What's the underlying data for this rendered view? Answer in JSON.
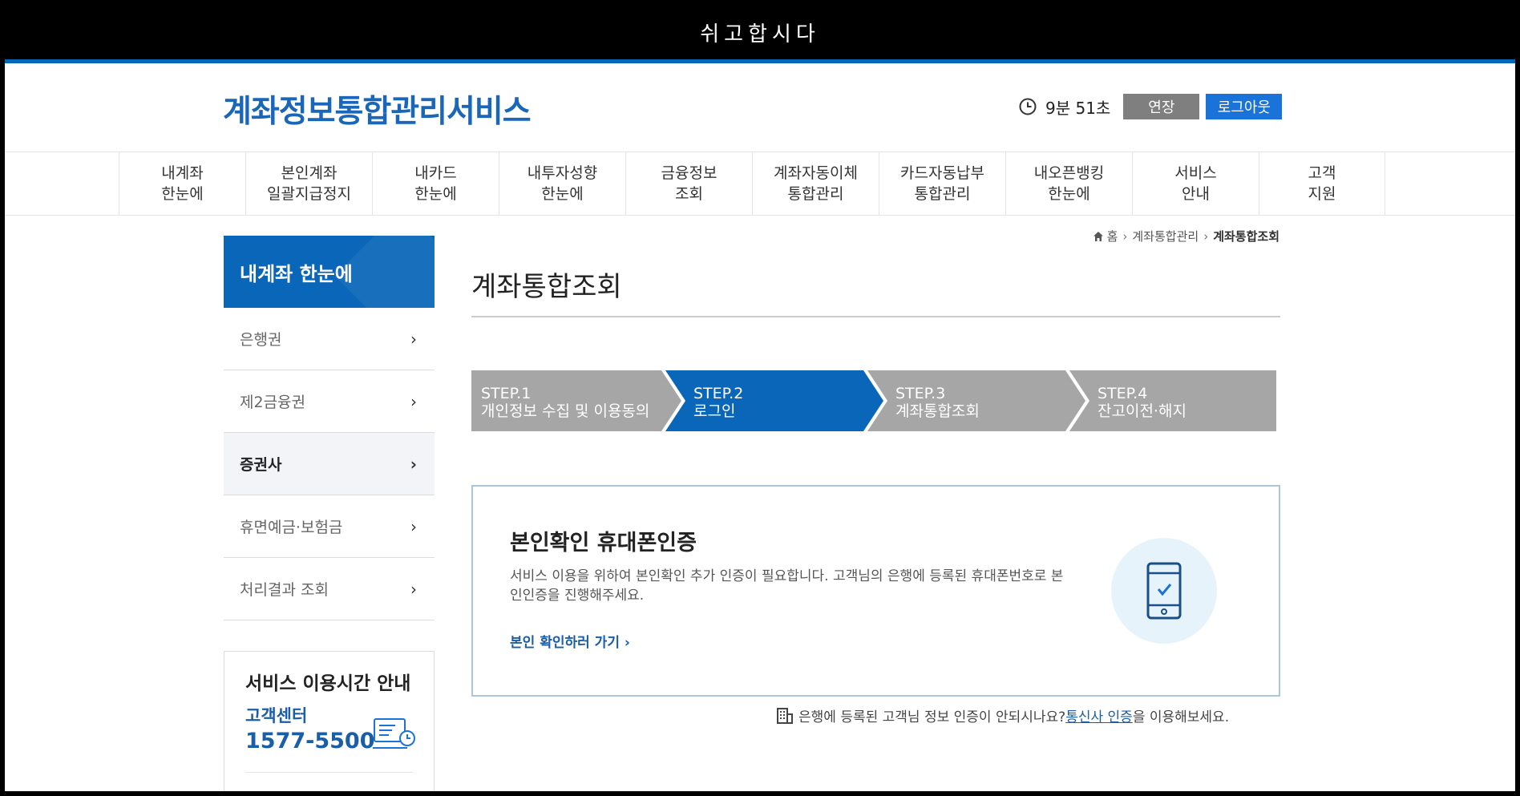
{
  "window": {
    "title": "쉬고합시다"
  },
  "header": {
    "logo": "계좌정보통합관리서비스",
    "session_timer": "9분 51초",
    "extend_label": "연장",
    "logout_label": "로그아웃"
  },
  "gnb": [
    {
      "label": "내계좌\n한눈에"
    },
    {
      "label": "본인계좌\n일괄지급정지"
    },
    {
      "label": "내카드\n한눈에"
    },
    {
      "label": "내투자성향\n한눈에"
    },
    {
      "label": "금융정보\n조회"
    },
    {
      "label": "계좌자동이체\n통합관리"
    },
    {
      "label": "카드자동납부\n통합관리"
    },
    {
      "label": "내오픈뱅킹\n한눈에"
    },
    {
      "label": "서비스\n안내"
    },
    {
      "label": "고객\n지원"
    }
  ],
  "breadcrumb": {
    "home": "홈",
    "level1": "계좌통합관리",
    "current": "계좌통합조회"
  },
  "sidebar": {
    "title": "내계좌 한눈에",
    "items": [
      {
        "label": "은행권"
      },
      {
        "label": "제2금융권"
      },
      {
        "label": "증권사"
      },
      {
        "label": "휴면예금·보험금"
      },
      {
        "label": "처리결과 조회"
      }
    ],
    "service_box": {
      "title": "서비스 이용시간 안내",
      "center_label": "고객센터",
      "phone": "1577-5500"
    }
  },
  "content": {
    "page_title": "계좌통합조회",
    "steps": [
      {
        "step": "STEP.1",
        "label": "개인정보 수집 및 이용동의",
        "active": false
      },
      {
        "step": "STEP.2",
        "label": "로그인",
        "active": true
      },
      {
        "step": "STEP.3",
        "label": "계좌통합조회",
        "active": false
      },
      {
        "step": "STEP.4",
        "label": "잔고이전·해지",
        "active": false
      }
    ],
    "verify": {
      "title": "본인확인 휴대폰인증",
      "desc": "서비스 이용을 위하여 본인확인 추가 인증이 필요합니다. 고객님의 은행에 등록된 휴대폰번호로 본인인증을 진행해주세요.",
      "link": "본인 확인하러 가기 ›"
    },
    "notice": {
      "before": "은행에 등록된 고객님 정보 인증이 안되시나요? ",
      "link": "통신사 인증",
      "after": "을 이용해보세요."
    }
  },
  "colors": {
    "accent": "#0068b7",
    "step_active": "#0a66b8",
    "step_inactive": "#a6a6a6",
    "logout_button": "#1a73d9",
    "extend_button": "#7f7f7f"
  }
}
